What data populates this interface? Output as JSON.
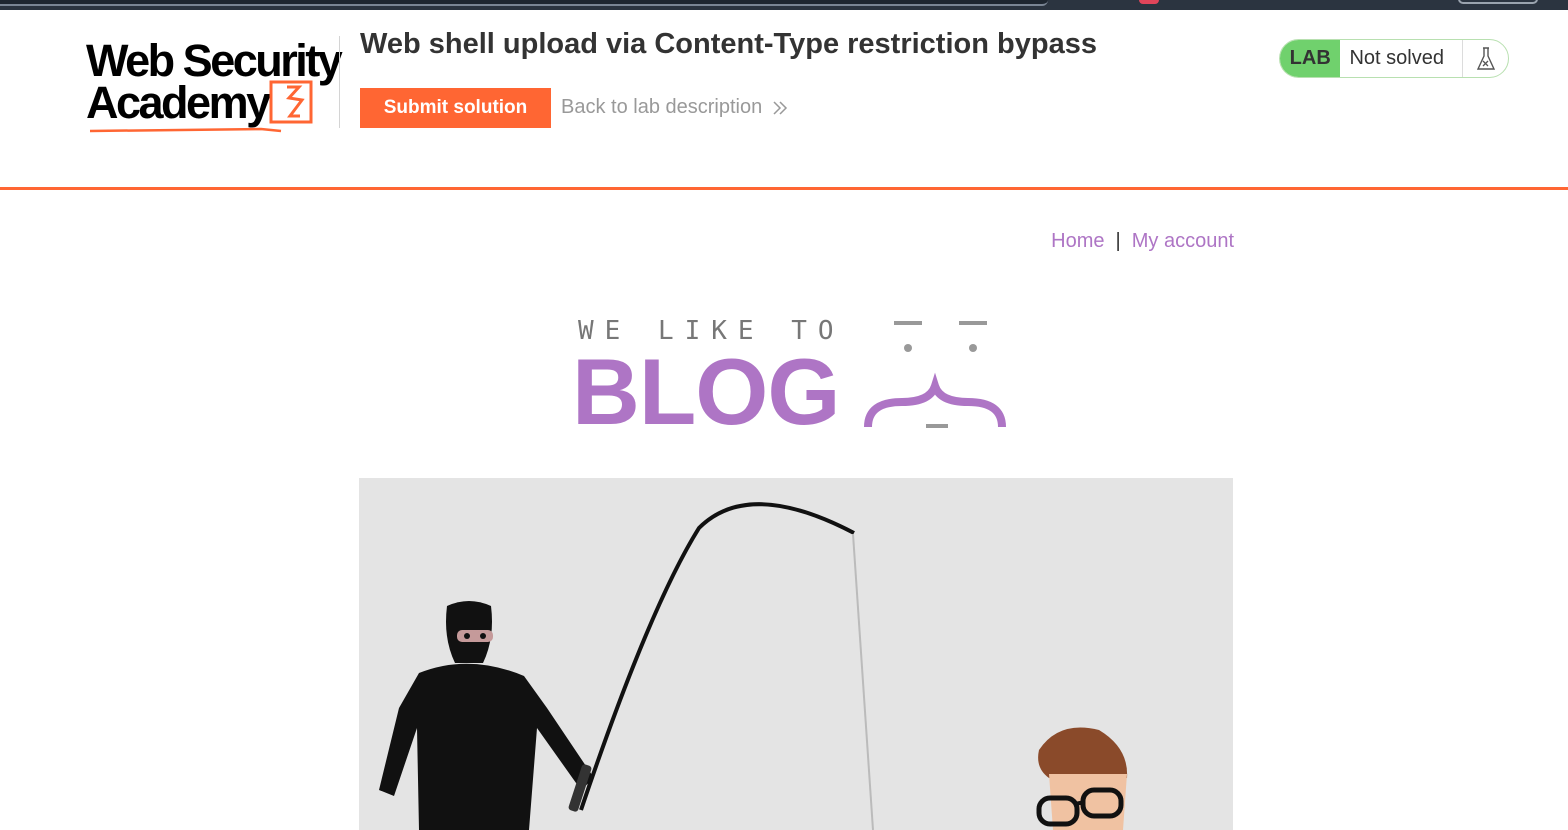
{
  "academy": {
    "logo_line1": "Web Security",
    "logo_line2": "Academy",
    "lab_title": "Web shell upload via Content-Type restriction bypass",
    "submit_label": "Submit solution",
    "back_label": "Back to lab description",
    "status_badge": "LAB",
    "status_text": "Not solved",
    "accent_color": "#ff6633",
    "status_color": "#70d16d"
  },
  "nav": {
    "home": "Home",
    "separator": "|",
    "account": "My account"
  },
  "blog": {
    "tagline": "WE LIKE TO",
    "name": "BLOG",
    "brand_color": "#ae75c5"
  },
  "post": {
    "image_icon": "phishing-illustration"
  }
}
